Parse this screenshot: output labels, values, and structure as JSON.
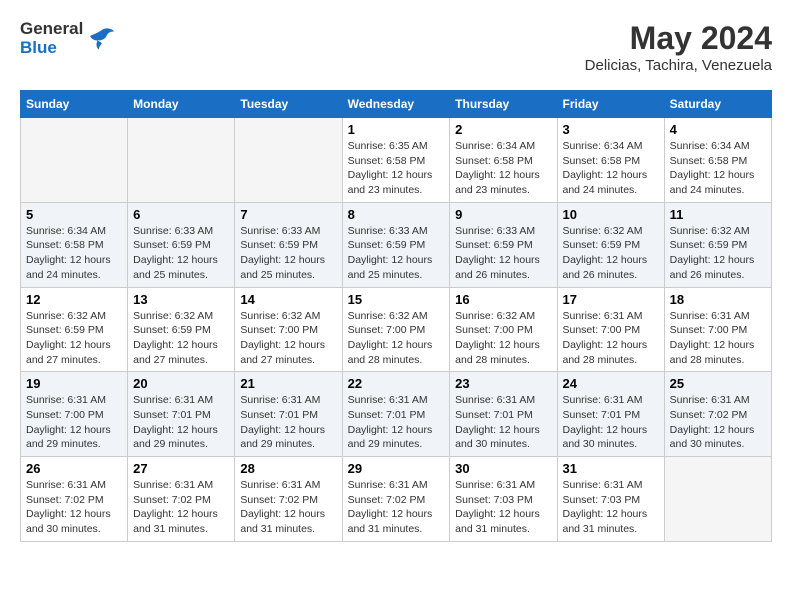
{
  "header": {
    "logo_general": "General",
    "logo_blue": "Blue",
    "month_title": "May 2024",
    "location": "Delicias, Tachira, Venezuela"
  },
  "weekdays": [
    "Sunday",
    "Monday",
    "Tuesday",
    "Wednesday",
    "Thursday",
    "Friday",
    "Saturday"
  ],
  "weeks": [
    [
      {
        "day": "",
        "info": ""
      },
      {
        "day": "",
        "info": ""
      },
      {
        "day": "",
        "info": ""
      },
      {
        "day": "1",
        "info": "Sunrise: 6:35 AM\nSunset: 6:58 PM\nDaylight: 12 hours\nand 23 minutes."
      },
      {
        "day": "2",
        "info": "Sunrise: 6:34 AM\nSunset: 6:58 PM\nDaylight: 12 hours\nand 23 minutes."
      },
      {
        "day": "3",
        "info": "Sunrise: 6:34 AM\nSunset: 6:58 PM\nDaylight: 12 hours\nand 24 minutes."
      },
      {
        "day": "4",
        "info": "Sunrise: 6:34 AM\nSunset: 6:58 PM\nDaylight: 12 hours\nand 24 minutes."
      }
    ],
    [
      {
        "day": "5",
        "info": "Sunrise: 6:34 AM\nSunset: 6:58 PM\nDaylight: 12 hours\nand 24 minutes."
      },
      {
        "day": "6",
        "info": "Sunrise: 6:33 AM\nSunset: 6:59 PM\nDaylight: 12 hours\nand 25 minutes."
      },
      {
        "day": "7",
        "info": "Sunrise: 6:33 AM\nSunset: 6:59 PM\nDaylight: 12 hours\nand 25 minutes."
      },
      {
        "day": "8",
        "info": "Sunrise: 6:33 AM\nSunset: 6:59 PM\nDaylight: 12 hours\nand 25 minutes."
      },
      {
        "day": "9",
        "info": "Sunrise: 6:33 AM\nSunset: 6:59 PM\nDaylight: 12 hours\nand 26 minutes."
      },
      {
        "day": "10",
        "info": "Sunrise: 6:32 AM\nSunset: 6:59 PM\nDaylight: 12 hours\nand 26 minutes."
      },
      {
        "day": "11",
        "info": "Sunrise: 6:32 AM\nSunset: 6:59 PM\nDaylight: 12 hours\nand 26 minutes."
      }
    ],
    [
      {
        "day": "12",
        "info": "Sunrise: 6:32 AM\nSunset: 6:59 PM\nDaylight: 12 hours\nand 27 minutes."
      },
      {
        "day": "13",
        "info": "Sunrise: 6:32 AM\nSunset: 6:59 PM\nDaylight: 12 hours\nand 27 minutes."
      },
      {
        "day": "14",
        "info": "Sunrise: 6:32 AM\nSunset: 7:00 PM\nDaylight: 12 hours\nand 27 minutes."
      },
      {
        "day": "15",
        "info": "Sunrise: 6:32 AM\nSunset: 7:00 PM\nDaylight: 12 hours\nand 28 minutes."
      },
      {
        "day": "16",
        "info": "Sunrise: 6:32 AM\nSunset: 7:00 PM\nDaylight: 12 hours\nand 28 minutes."
      },
      {
        "day": "17",
        "info": "Sunrise: 6:31 AM\nSunset: 7:00 PM\nDaylight: 12 hours\nand 28 minutes."
      },
      {
        "day": "18",
        "info": "Sunrise: 6:31 AM\nSunset: 7:00 PM\nDaylight: 12 hours\nand 28 minutes."
      }
    ],
    [
      {
        "day": "19",
        "info": "Sunrise: 6:31 AM\nSunset: 7:00 PM\nDaylight: 12 hours\nand 29 minutes."
      },
      {
        "day": "20",
        "info": "Sunrise: 6:31 AM\nSunset: 7:01 PM\nDaylight: 12 hours\nand 29 minutes."
      },
      {
        "day": "21",
        "info": "Sunrise: 6:31 AM\nSunset: 7:01 PM\nDaylight: 12 hours\nand 29 minutes."
      },
      {
        "day": "22",
        "info": "Sunrise: 6:31 AM\nSunset: 7:01 PM\nDaylight: 12 hours\nand 29 minutes."
      },
      {
        "day": "23",
        "info": "Sunrise: 6:31 AM\nSunset: 7:01 PM\nDaylight: 12 hours\nand 30 minutes."
      },
      {
        "day": "24",
        "info": "Sunrise: 6:31 AM\nSunset: 7:01 PM\nDaylight: 12 hours\nand 30 minutes."
      },
      {
        "day": "25",
        "info": "Sunrise: 6:31 AM\nSunset: 7:02 PM\nDaylight: 12 hours\nand 30 minutes."
      }
    ],
    [
      {
        "day": "26",
        "info": "Sunrise: 6:31 AM\nSunset: 7:02 PM\nDaylight: 12 hours\nand 30 minutes."
      },
      {
        "day": "27",
        "info": "Sunrise: 6:31 AM\nSunset: 7:02 PM\nDaylight: 12 hours\nand 31 minutes."
      },
      {
        "day": "28",
        "info": "Sunrise: 6:31 AM\nSunset: 7:02 PM\nDaylight: 12 hours\nand 31 minutes."
      },
      {
        "day": "29",
        "info": "Sunrise: 6:31 AM\nSunset: 7:02 PM\nDaylight: 12 hours\nand 31 minutes."
      },
      {
        "day": "30",
        "info": "Sunrise: 6:31 AM\nSunset: 7:03 PM\nDaylight: 12 hours\nand 31 minutes."
      },
      {
        "day": "31",
        "info": "Sunrise: 6:31 AM\nSunset: 7:03 PM\nDaylight: 12 hours\nand 31 minutes."
      },
      {
        "day": "",
        "info": ""
      }
    ]
  ]
}
